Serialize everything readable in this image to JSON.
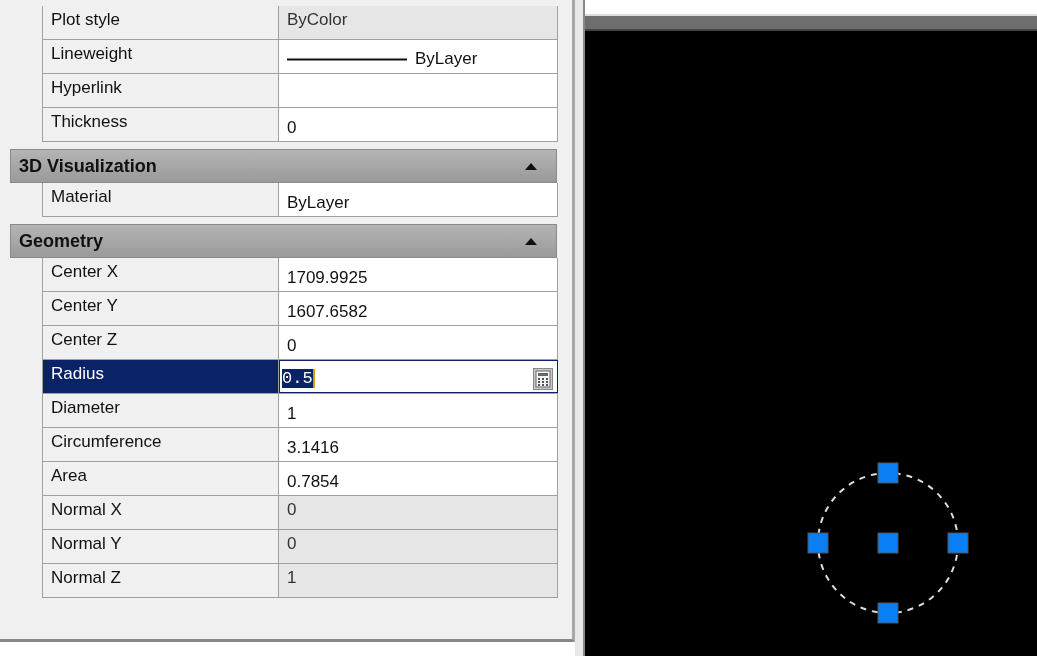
{
  "rows": [
    {
      "label": "Plot style",
      "value": "ByColor",
      "kind": "text",
      "readonly": true,
      "selected": false
    },
    {
      "label": "Lineweight",
      "value": "ByLayer",
      "kind": "lineweight",
      "readonly": false,
      "selected": false
    },
    {
      "label": "Hyperlink",
      "value": "",
      "kind": "text",
      "readonly": false,
      "selected": false
    },
    {
      "label": "Thickness",
      "value": "0",
      "kind": "text",
      "readonly": false,
      "selected": false
    }
  ],
  "sections": [
    {
      "title": "3D Visualization",
      "expanded": true,
      "rows": [
        {
          "label": "Material",
          "value": "ByLayer",
          "kind": "text",
          "readonly": false,
          "selected": false
        }
      ]
    },
    {
      "title": "Geometry",
      "expanded": true,
      "rows": [
        {
          "label": "Center X",
          "value": "1709.9925",
          "kind": "text",
          "readonly": false,
          "selected": false
        },
        {
          "label": "Center Y",
          "value": "1607.6582",
          "kind": "text",
          "readonly": false,
          "selected": false
        },
        {
          "label": "Center Z",
          "value": "0",
          "kind": "text",
          "readonly": false,
          "selected": false
        },
        {
          "label": "Radius",
          "value": "0.5",
          "kind": "text",
          "readonly": false,
          "selected": true
        },
        {
          "label": "Diameter",
          "value": "1",
          "kind": "text",
          "readonly": false,
          "selected": false
        },
        {
          "label": "Circumference",
          "value": "3.1416",
          "kind": "text",
          "readonly": false,
          "selected": false
        },
        {
          "label": "Area",
          "value": "0.7854",
          "kind": "text",
          "readonly": false,
          "selected": false
        },
        {
          "label": "Normal X",
          "value": "0",
          "kind": "text",
          "readonly": true,
          "selected": false
        },
        {
          "label": "Normal Y",
          "value": "0",
          "kind": "text",
          "readonly": true,
          "selected": false
        },
        {
          "label": "Normal Z",
          "value": "1",
          "kind": "text",
          "readonly": true,
          "selected": false
        }
      ]
    }
  ]
}
